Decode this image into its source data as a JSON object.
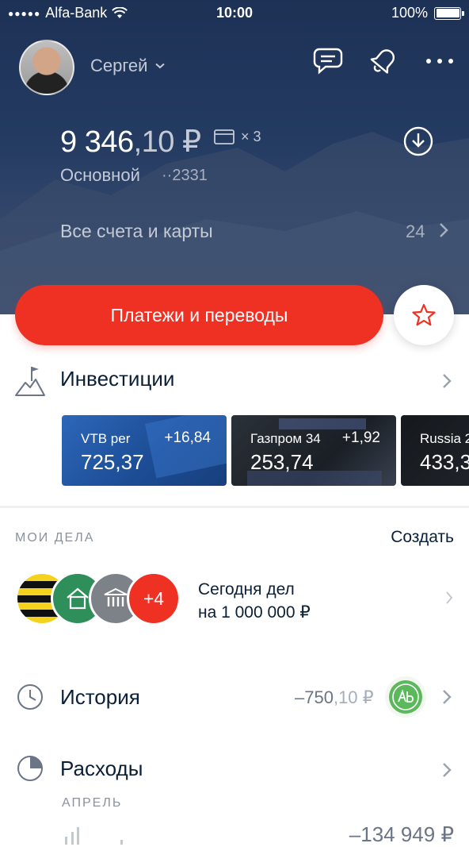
{
  "status_bar": {
    "carrier": "Alfa-Bank",
    "time": "10:00",
    "battery": "100%"
  },
  "profile": {
    "name": "Сергей"
  },
  "account": {
    "balance_main": "9 346",
    "balance_kopecks": ",10 ₽",
    "cards_count": "× 3",
    "name": "Основной",
    "number": "··2331"
  },
  "all_accounts": {
    "label": "Все счета и карты",
    "count": "24"
  },
  "payments": {
    "label": "Платежи и переводы"
  },
  "investments": {
    "title": "Инвестиции",
    "tiles": [
      {
        "name": "VTB per",
        "change": "+16,84",
        "price": "725,37"
      },
      {
        "name": "Газпром 34",
        "change": "+1,92",
        "price": "253,74"
      },
      {
        "name": "Russia 2",
        "change": "",
        "price": "433,3"
      }
    ]
  },
  "tasks": {
    "caption": "МОИ ДЕЛА",
    "create_label": "Создать",
    "more_count": "+4",
    "summary_line1": "Сегодня дел",
    "summary_line2": "на 1 000 000 ₽"
  },
  "history": {
    "title": "История",
    "amount_main": "–750",
    "amount_kopecks": ",10 ₽"
  },
  "expenses": {
    "title": "Расходы",
    "month": "АПРЕЛЬ",
    "amount": "–134 949 ₽"
  },
  "colors": {
    "accent": "#ef3124",
    "header_bg": "#243b62",
    "text": "#0b1f35",
    "muted": "#8a929e"
  }
}
